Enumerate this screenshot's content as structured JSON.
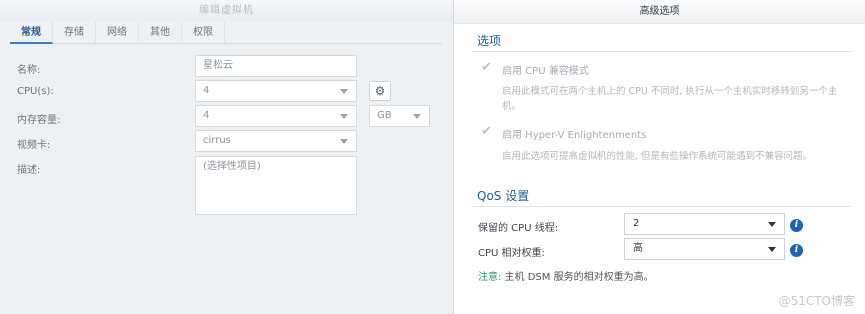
{
  "left_dialog": {
    "title": "编辑虚拟机",
    "tabs": [
      "常规",
      "存储",
      "网络",
      "其他",
      "权限"
    ],
    "fields": {
      "name_label": "名称:",
      "name_value": "星松云",
      "cpu_label": "CPU(s):",
      "cpu_value": "4",
      "memory_label": "内存容量:",
      "memory_value": "4",
      "memory_unit": "GB",
      "video_label": "视频卡:",
      "video_value": "cirrus",
      "desc_label": "描述:",
      "desc_placeholder": "(选择性项目)"
    }
  },
  "right_panel": {
    "title": "高级选项",
    "options_section": "选项",
    "option1_label": "启用 CPU 兼容模式",
    "option1_desc": "启用此模式可在两个主机上的 CPU 不同时, 执行从一个主机实时移转到另一个主机。",
    "option2_label": "启用 Hyper-V Enlightenments",
    "option2_desc": "启用此选项可提高虚拟机的性能, 但是有些操作系统可能遇到不兼容问题。",
    "qos_section": "QoS 设置",
    "reserved_cpu_label": "保留的 CPU 线程:",
    "reserved_cpu_value": "2",
    "cpu_weight_label": "CPU 相对权重:",
    "cpu_weight_value": "高",
    "note_prefix": "注意:",
    "note_text": " 主机 DSM 服务的相对权重为高。"
  },
  "watermark": "@51CTO博客",
  "colors": {
    "accent": "#1f5d99",
    "info": "#1d63b8",
    "note": "#2a9a6a"
  }
}
